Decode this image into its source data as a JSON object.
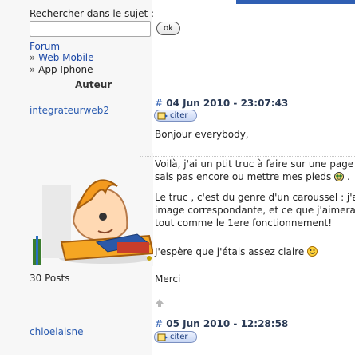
{
  "search": {
    "label": "Rechercher dans le sujet :",
    "value": "",
    "placeholder": "",
    "button": "ok"
  },
  "breadcrumb": {
    "root": "Forum",
    "sep": "» ",
    "items": [
      "Web Mobile",
      "App Iphone"
    ]
  },
  "table": {
    "author_header": "Auteur"
  },
  "posts": [
    {
      "author": "integrateurweb2",
      "post_count": "30 Posts",
      "hash": "#",
      "date": " 04 Jun 2010 - 23:07:43",
      "cite_label": "citer",
      "lines": [
        "Bonjour everybody,",
        "Voilà, j'ai un ptit truc à faire sur une page h",
        "sais pas encore ou mettre mes pieds",
        "Le truc , c'est du genre d'un caroussel : j'ai d",
        "image correspondante, et ce que j'aimerai f",
        "tout comme le 1ere fonctionnement!",
        "J'espère que j'étais assez claire",
        "Merci"
      ]
    },
    {
      "author": "chloelaisne",
      "hash": "#",
      "date": " 05 Jun 2010 - 12:28:58",
      "cite_label": "citer"
    }
  ],
  "colors": {
    "link": "#2a5bb0",
    "accent_bar": "#2f5fb3",
    "sidebar_bg": "#f7f7f7"
  },
  "icons": [
    "cite-icon",
    "nerd-smiley-icon",
    "happy-smiley-icon",
    "up-arrow-icon"
  ]
}
